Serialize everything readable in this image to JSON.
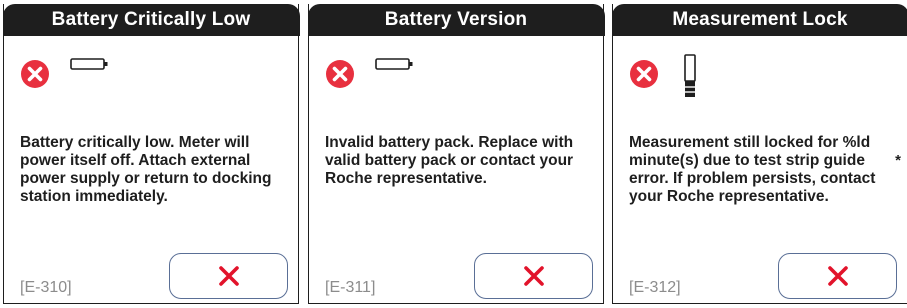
{
  "colors": {
    "header_bg": "#1e1e1e",
    "error_red": "#e8303f",
    "close_red": "#e2132b",
    "code_gray": "#8c8c8c",
    "button_border": "#5a6f96"
  },
  "panels": [
    {
      "title": "Battery Critically Low",
      "status_icon": "error-circle-icon",
      "device_icon": "battery-empty-icon",
      "message": "Battery critically low. Meter will power itself off. Attach external power supply or return to docking station immediately.",
      "code": "[E-310]",
      "close_icon": "close-icon"
    },
    {
      "title": "Battery Version",
      "status_icon": "error-circle-icon",
      "device_icon": "battery-empty-icon",
      "message": "Invalid battery pack. Replace with valid battery pack or contact your Roche representative.",
      "code": "[E-311]",
      "close_icon": "close-icon"
    },
    {
      "title": "Measurement Lock",
      "status_icon": "error-circle-icon",
      "device_icon": "test-strip-guide-icon",
      "message": "Measurement still locked for %ld minute(s) due to test strip guide error. If problem persists, contact your Roche representative.",
      "code": "[E-312]",
      "close_icon": "close-icon",
      "footnote_mark": "*"
    }
  ]
}
